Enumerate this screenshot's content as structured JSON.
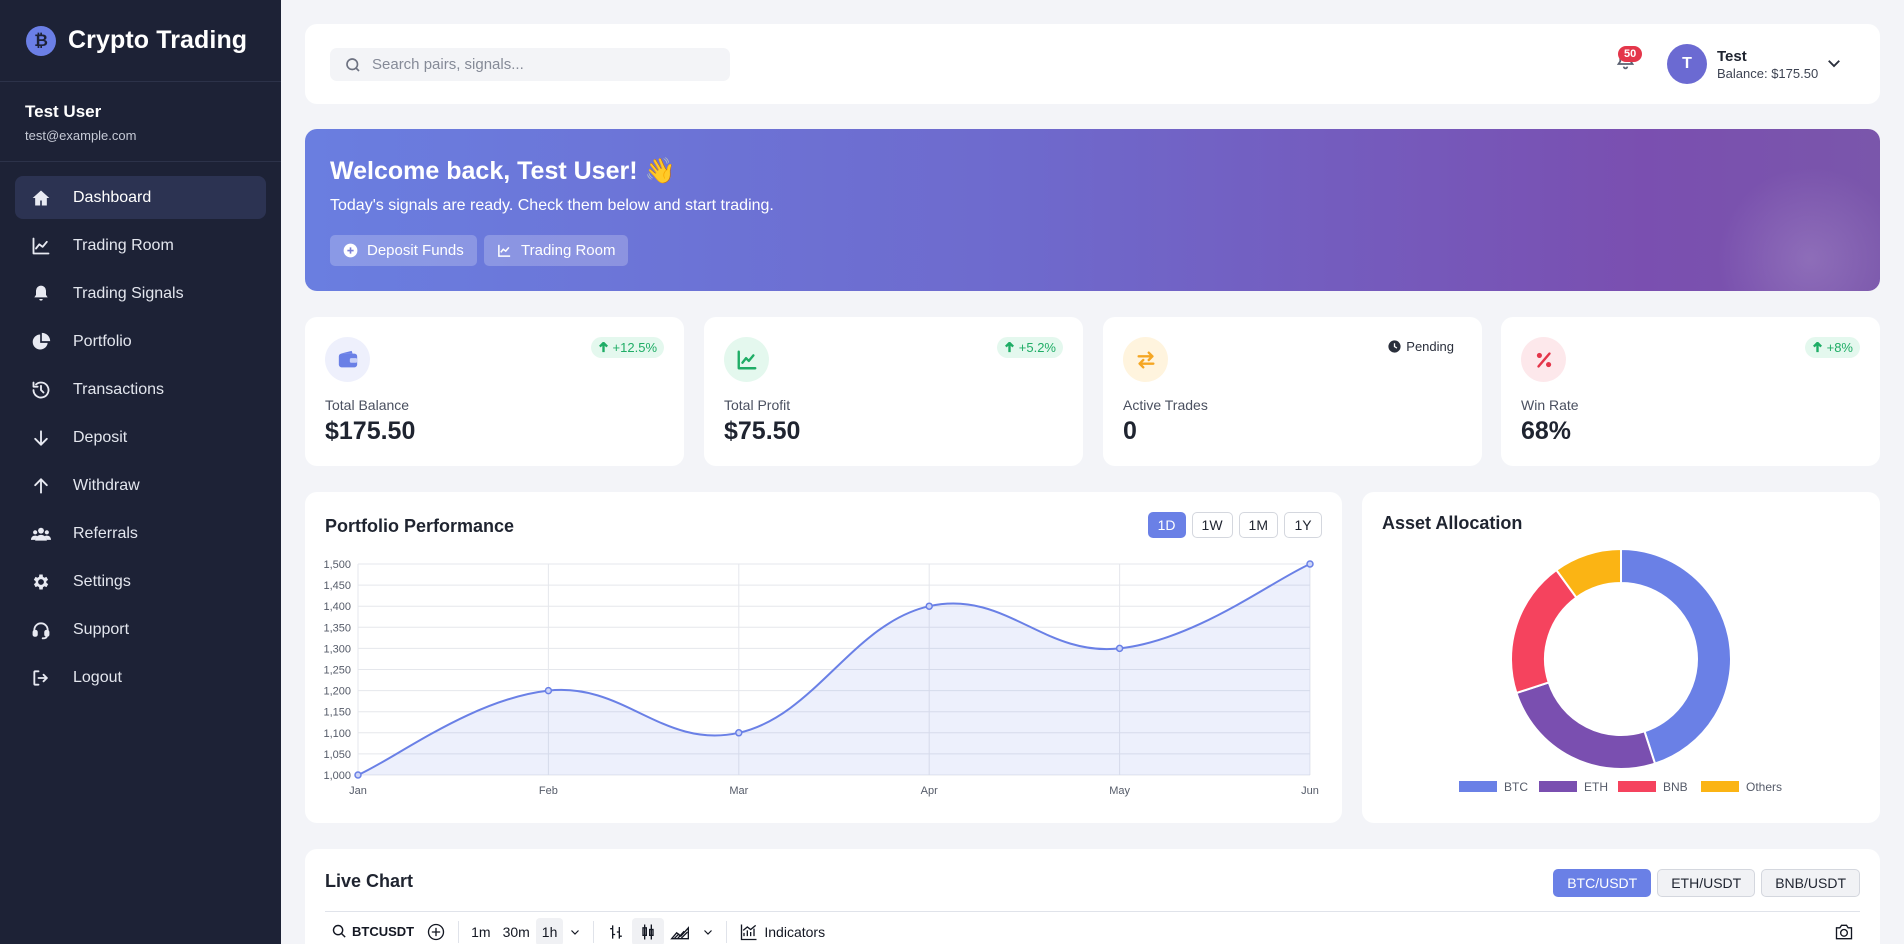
{
  "brand": {
    "logo_letter": "₿",
    "title": "Crypto Trading"
  },
  "user": {
    "name": "Test User",
    "email": "test@example.com"
  },
  "nav": [
    {
      "label": "Dashboard",
      "icon": "home-icon",
      "active": true
    },
    {
      "label": "Trading Room",
      "icon": "line-chart-icon"
    },
    {
      "label": "Trading Signals",
      "icon": "bell-icon"
    },
    {
      "label": "Portfolio",
      "icon": "pie-chart-icon"
    },
    {
      "label": "Transactions",
      "icon": "history-icon"
    },
    {
      "label": "Deposit",
      "icon": "arrow-down-icon"
    },
    {
      "label": "Withdraw",
      "icon": "arrow-up-icon"
    },
    {
      "label": "Referrals",
      "icon": "users-icon"
    },
    {
      "label": "Settings",
      "icon": "gear-icon"
    },
    {
      "label": "Support",
      "icon": "headset-icon"
    },
    {
      "label": "Logout",
      "icon": "logout-icon"
    }
  ],
  "header": {
    "search_placeholder": "Search pairs, signals...",
    "notification_count": "50",
    "avatar_letter": "T",
    "profile_name": "Test",
    "profile_balance": "Balance: $175.50"
  },
  "banner": {
    "title": "Welcome back, Test User! 👋",
    "subtitle": "Today's signals are ready. Check them below and start trading.",
    "deposit_label": "Deposit Funds",
    "trading_room_label": "Trading Room"
  },
  "stats": [
    {
      "label": "Total Balance",
      "value": "$175.50",
      "badge": "+12.5%",
      "icon": "wallet-icon",
      "color": "#6a80e6",
      "bg": "#eef0fc"
    },
    {
      "label": "Total Profit",
      "value": "$75.50",
      "badge": "+5.2%",
      "icon": "trend-up-icon",
      "color": "#1fad66",
      "bg": "#e4f8ee"
    },
    {
      "label": "Active Trades",
      "value": "0",
      "status": "Pending",
      "icon": "exchange-icon",
      "color": "#f5a623",
      "bg": "#fff4de"
    },
    {
      "label": "Win Rate",
      "value": "68%",
      "badge": "+8%",
      "icon": "percent-icon",
      "color": "#e4364a",
      "bg": "#fde8eb"
    }
  ],
  "performance": {
    "title": "Portfolio Performance",
    "ranges": [
      "1D",
      "1W",
      "1M",
      "1Y"
    ],
    "active_range": "1D"
  },
  "allocation": {
    "title": "Asset Allocation"
  },
  "live_chart": {
    "title": "Live Chart",
    "pairs": [
      "BTC/USDT",
      "ETH/USDT",
      "BNB/USDT"
    ],
    "active_pair": "BTC/USDT",
    "symbol": "BTCUSDT",
    "intervals": [
      "1m",
      "30m",
      "1h"
    ],
    "active_interval": "1h",
    "indicators_label": "Indicators"
  },
  "chart_data": [
    {
      "type": "line",
      "title": "Portfolio Performance",
      "categories": [
        "Jan",
        "Feb",
        "Mar",
        "Apr",
        "May",
        "Jun"
      ],
      "values": [
        1000,
        1200,
        1100,
        1400,
        1300,
        1500
      ],
      "ylim": [
        1000,
        1500
      ],
      "yticks": [
        1000,
        1050,
        1100,
        1150,
        1200,
        1250,
        1300,
        1350,
        1400,
        1450,
        1500
      ],
      "fill": true,
      "grid": true,
      "color": "#6a80e6"
    },
    {
      "type": "pie",
      "title": "Asset Allocation",
      "labels": [
        "BTC",
        "ETH",
        "BNB",
        "Others"
      ],
      "values": [
        45,
        25,
        20,
        10
      ],
      "colors": [
        "#6a80e6",
        "#7a4fb0",
        "#f5435e",
        "#fbb414"
      ],
      "legend": "bottom"
    }
  ]
}
